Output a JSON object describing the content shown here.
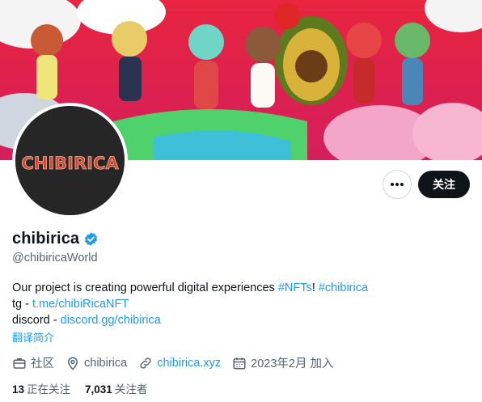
{
  "profile": {
    "display_name": "chibirica",
    "handle": "@chibiricaWorld",
    "avatar_text": "CHIBIRICA",
    "bio": {
      "line1_text": "Our project is creating powerful digital experiences ",
      "hashtag1": "#NFTs",
      "line1_mid": "! ",
      "hashtag2": "#chibirica",
      "line2_prefix": "tg - ",
      "line2_link": "t.me/chibiRicaNFT",
      "line3_prefix": "discord - ",
      "line3_link": "discord.gg/chibirica"
    },
    "translate_label": "翻译简介",
    "meta": {
      "category": "社区",
      "location": "chibirica",
      "website": "chibirica.xyz",
      "joined": "2023年2月 加入"
    },
    "stats": {
      "following_count": "13",
      "following_label": "正在关注",
      "followers_count": "7,031",
      "followers_label": "关注者"
    }
  },
  "actions": {
    "follow_label": "关注"
  },
  "colors": {
    "accent": "#1d9bf0",
    "text": "#0f1419",
    "muted": "#536471",
    "verified": "#1d9bf0"
  },
  "icons": [
    "more-icon",
    "verified-badge-icon",
    "briefcase-icon",
    "location-icon",
    "link-icon",
    "calendar-icon"
  ]
}
